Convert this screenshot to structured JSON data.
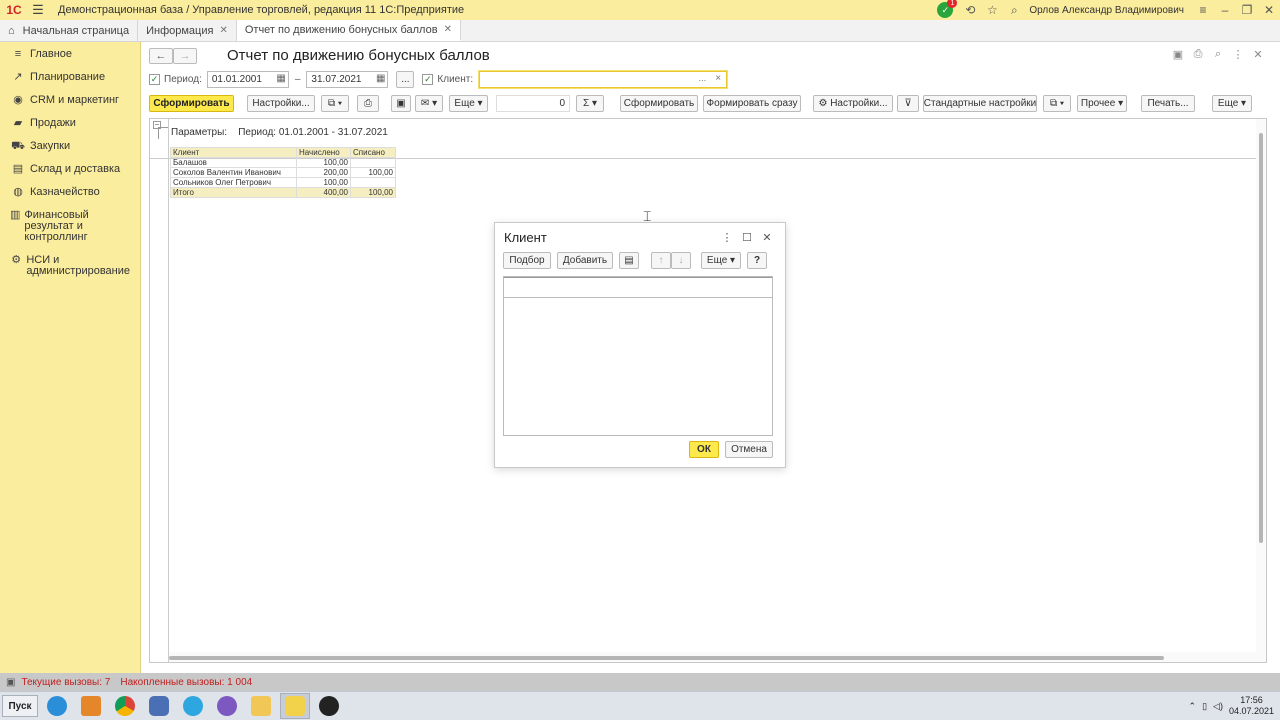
{
  "titlebar": {
    "logo": "1C",
    "title": "Демонстрационная база / Управление торговлей, редакция 11 1С:Предприятие",
    "notification_count": "1",
    "user": "Орлов Александр Владимирович"
  },
  "tabs": [
    {
      "label": "Начальная страница",
      "icon": "home-icon"
    },
    {
      "label": "Информация"
    },
    {
      "label": "Отчет по движению бонусных баллов"
    }
  ],
  "sidebar": {
    "items": [
      {
        "label": "Главное",
        "icon": "menu-icon"
      },
      {
        "label": "Планирование",
        "icon": "planning-icon"
      },
      {
        "label": "CRM и маркетинг",
        "icon": "crm-icon"
      },
      {
        "label": "Продажи",
        "icon": "sales-icon"
      },
      {
        "label": "Закупки",
        "icon": "purchases-icon"
      },
      {
        "label": "Склад и доставка",
        "icon": "warehouse-icon"
      },
      {
        "label": "Казначейство",
        "icon": "treasury-icon"
      },
      {
        "label": "Финансовый результат и контроллинг",
        "icon": "finance-icon"
      },
      {
        "label": "НСИ и администрирование",
        "icon": "admin-gear-icon"
      }
    ]
  },
  "page": {
    "title": "Отчет по движению бонусных баллов"
  },
  "filters": {
    "period_label": "Период:",
    "date_from": "01.01.2001",
    "date_to": "31.07.2021",
    "dash": "–",
    "ellipsis": "...",
    "client_label": "Клиент:",
    "client_value": "",
    "client_dots": "...",
    "client_clear": "×"
  },
  "toolbar": {
    "generate": "Сформировать",
    "settings": "Настройки...",
    "more": "Еще",
    "sum_value": "0",
    "sigma": "Σ",
    "generate2": "Сформировать",
    "generate_now": "Формировать сразу",
    "settings2": "Настройки...",
    "standard_settings": "Стандартные настройки",
    "other": "Прочее",
    "print": "Печать...",
    "more2": "Еще"
  },
  "report": {
    "params_label": "Параметры:",
    "params_value": "Период: 01.01.2001 - 31.07.2021",
    "columns": [
      "Клиент",
      "Начислено",
      "Списано"
    ],
    "rows": [
      [
        "Балашов",
        "100,00",
        ""
      ],
      [
        "Соколов Валентин Иванович",
        "200,00",
        "100,00"
      ],
      [
        "Сольников Олег Петрович",
        "100,00",
        ""
      ]
    ],
    "total": [
      "Итого",
      "400,00",
      "100,00"
    ]
  },
  "dialog": {
    "title": "Клиент",
    "pick": "Подбор",
    "add": "Добавить",
    "more": "Еще",
    "help": "?",
    "ok": "ОК",
    "cancel": "Отмена"
  },
  "statusbar": {
    "current_calls": "Текущие вызовы: 7",
    "accumulated_calls": "Накопленные вызовы: 1 004"
  },
  "taskbar": {
    "start": "Пуск",
    "time": "17:56",
    "date": "04.07.2021"
  }
}
